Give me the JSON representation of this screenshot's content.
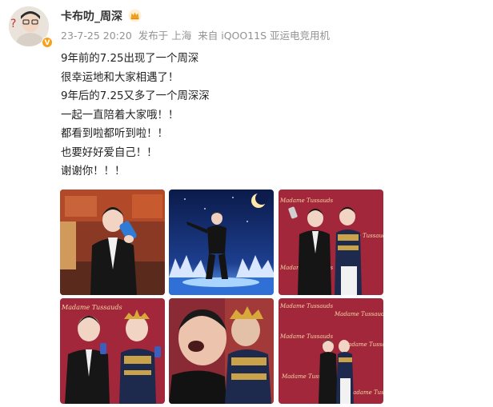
{
  "post": {
    "username": "卡布叻_周深",
    "verified_badge": "V",
    "meta": {
      "datetime": "23-7-25 20:20",
      "location": "发布于 上海",
      "source": "来自 iQOO11S 亚运电竞用机"
    },
    "text_lines": [
      "9年前的7.25出现了一个周深",
      "很幸运地和大家相遇了！",
      "9年后的7.25又多了一个周深深",
      "一起一直陪着大家哦！！",
      "都看到啦都听到啦！！",
      "也要好好爱自己！！",
      "谢谢你！！！"
    ],
    "photos": [
      {
        "name": "photo-1",
        "icon": "wax-figure-exhibit-photo"
      },
      {
        "name": "photo-2",
        "icon": "stage-night-moon-photo"
      },
      {
        "name": "photo-3",
        "icon": "madame-tussauds-duo-photo"
      },
      {
        "name": "photo-4",
        "icon": "madame-tussauds-closeup-photo"
      },
      {
        "name": "photo-5",
        "icon": "blurred-selfie-photo"
      },
      {
        "name": "photo-6",
        "icon": "madame-tussauds-wide-photo"
      }
    ]
  },
  "colors": {
    "text": "#222222",
    "meta": "#939393",
    "verified": "#f7a21b",
    "tussauds_red": "#a3273a"
  }
}
